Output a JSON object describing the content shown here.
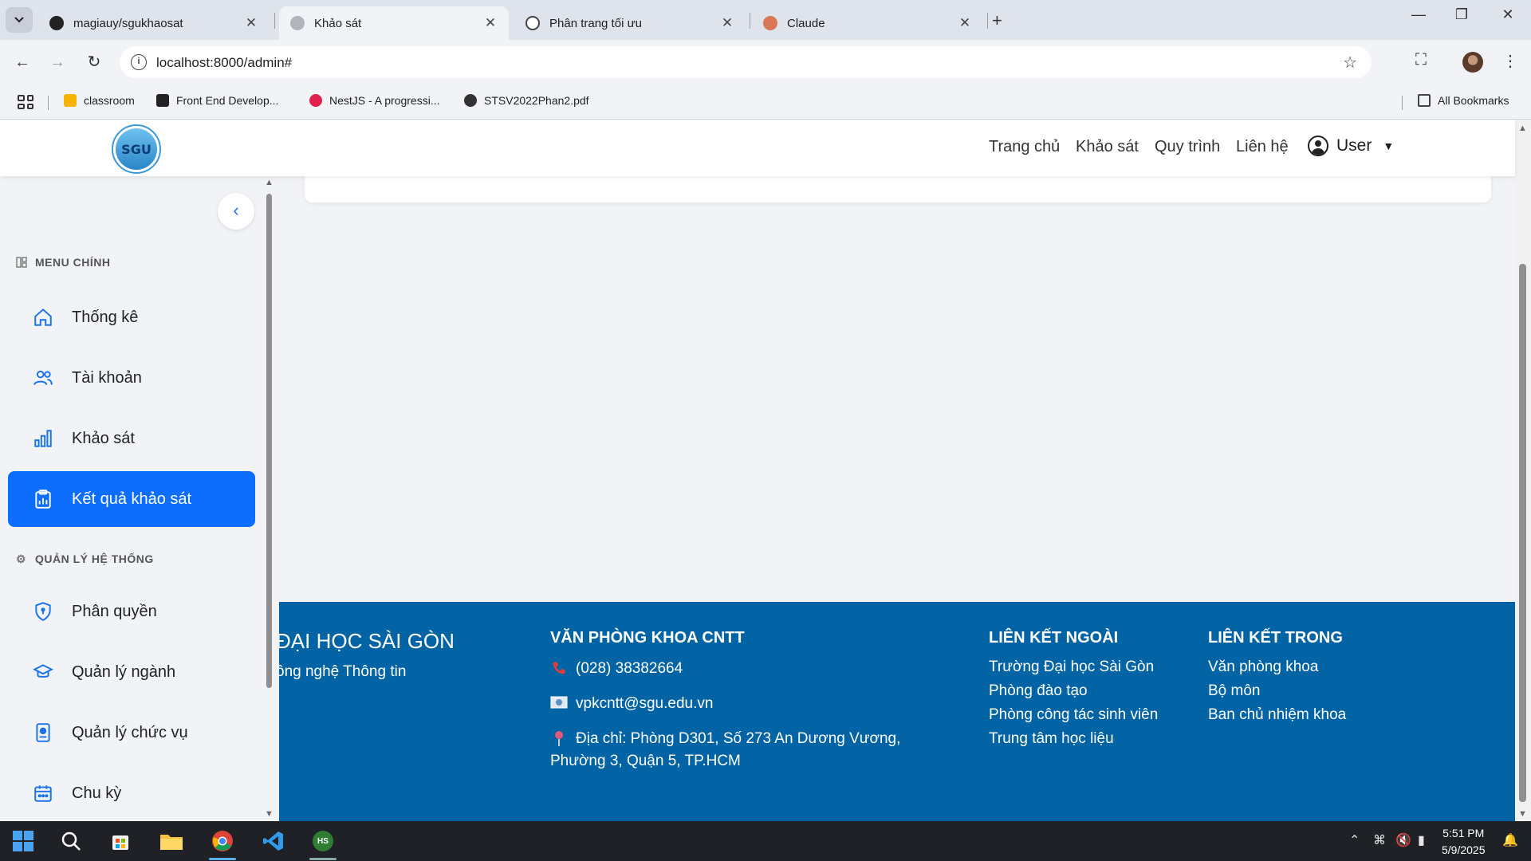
{
  "browser": {
    "tabs": [
      {
        "label": "magiauy/sgukhaosat",
        "close": "✕"
      },
      {
        "label": "Khảo sát",
        "close": "✕"
      },
      {
        "label": "Phân trang tối ưu",
        "close": "✕"
      },
      {
        "label": "Claude",
        "close": "✕"
      }
    ],
    "new_tab": "+",
    "url": "localhost:8000/admin#",
    "bookmarks": [
      {
        "label": "classroom"
      },
      {
        "label": "Front End Develop..."
      },
      {
        "label": "NestJS - A progressi..."
      },
      {
        "label": "STSV2022Phan2.pdf"
      }
    ],
    "all_bookmarks": "All Bookmarks"
  },
  "header": {
    "logo_text": "SGU",
    "nav": [
      "Trang chủ",
      "Khảo sát",
      "Quy trình",
      "Liên hệ"
    ],
    "user_label": "User"
  },
  "sidebar": {
    "section_main": "MENU CHÍNH",
    "section_system": "QUẢN LÝ HỆ THỐNG",
    "items": [
      {
        "label": "Thống kê",
        "icon": "home-icon"
      },
      {
        "label": "Tài khoản",
        "icon": "users-icon"
      },
      {
        "label": "Khảo sát",
        "icon": "bar-chart-icon"
      },
      {
        "label": "Kết quả khảo sát",
        "icon": "clipboard-chart-icon",
        "active": true
      },
      {
        "label": "Phân quyền",
        "icon": "shield-icon"
      },
      {
        "label": "Quản lý ngành",
        "icon": "graduation-cap-icon"
      },
      {
        "label": "Quản lý chức vụ",
        "icon": "id-badge-icon"
      },
      {
        "label": "Chu kỳ",
        "icon": "calendar-icon"
      }
    ]
  },
  "footer": {
    "university_title": "ĐẠI HỌC SÀI GÒN",
    "university_sub": "ông nghệ Thông tin",
    "office_heading": "VĂN PHÒNG KHOA CNTT",
    "phone": "(028) 38382664",
    "email": "vpkcntt@sgu.edu.vn",
    "address_line1": "Địa chỉ: Phòng D301, Số 273 An Dương Vương,",
    "address_line2": "Phường 3, Quận 5, TP.HCM",
    "external_heading": "LIÊN KẾT NGOÀI",
    "external_links": [
      "Trường Đại học Sài Gòn",
      "Phòng đào tạo",
      "Phòng công tác sinh viên",
      "Trung tâm học liệu"
    ],
    "internal_heading": "LIÊN KẾT TRONG",
    "internal_links": [
      "Văn phòng khoa",
      "Bộ môn",
      "Ban chủ nhiệm khoa"
    ]
  },
  "taskbar": {
    "time": "5:51 PM",
    "date": "5/9/2025",
    "app_badge": "HS"
  },
  "colors": {
    "accent": "#0d6efd",
    "footer_bg": "#0263a5",
    "icon_blue": "#1a73e8"
  }
}
